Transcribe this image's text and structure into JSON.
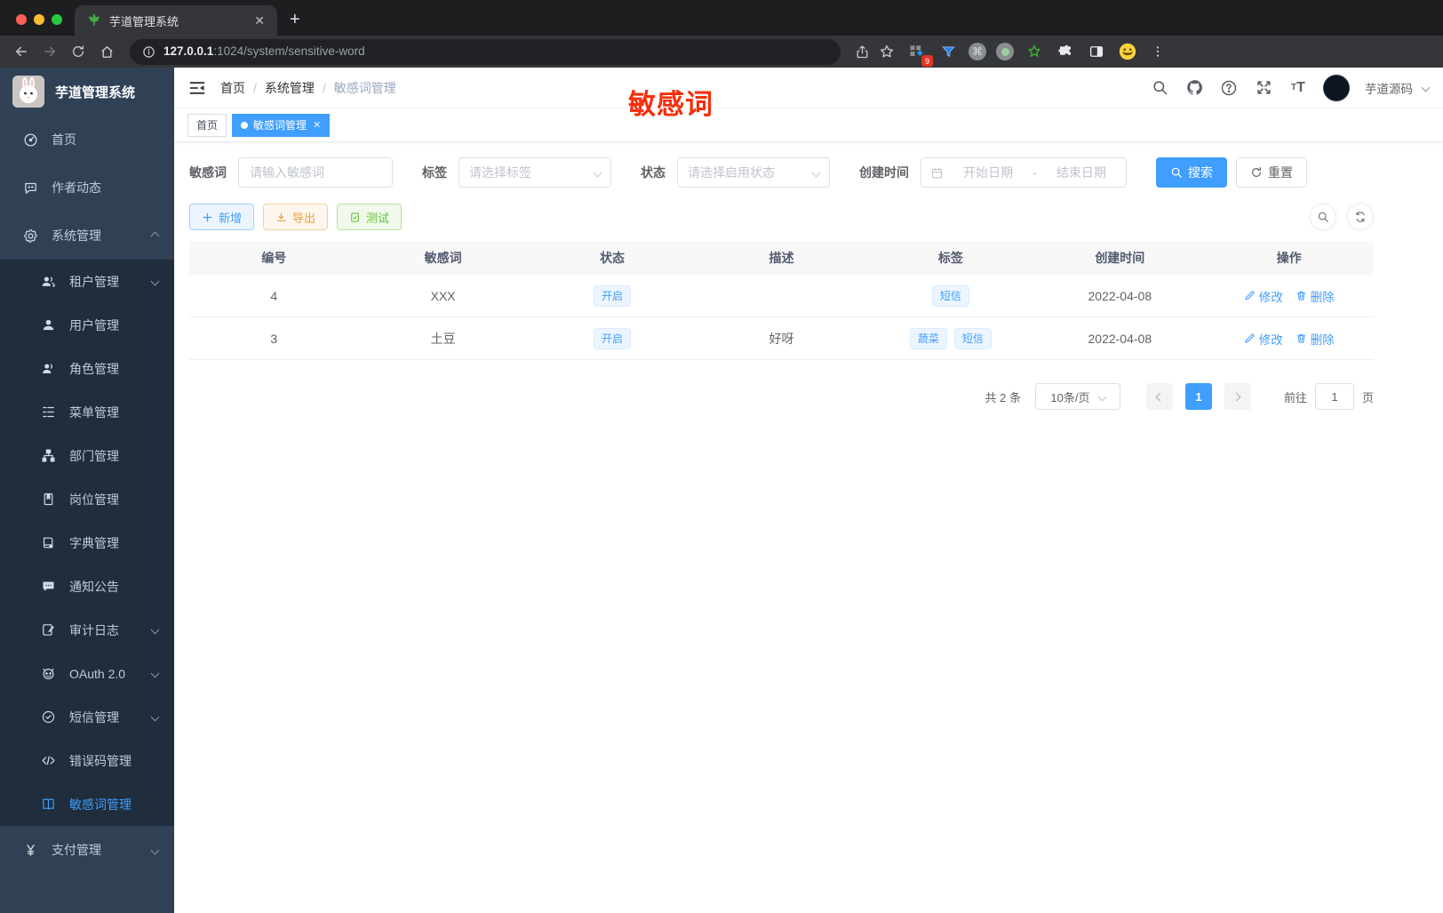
{
  "colors": {
    "accent": "#409eff",
    "sidebar_bg": "#304156",
    "submenu_bg": "#1f2d3d",
    "annotation_red": "#f62f0c",
    "tag_bg": "#ecf5ff",
    "tag_border": "#d9ecff",
    "warning": "#e6a23c",
    "success": "#67c23a"
  },
  "browser": {
    "tab_title": "芋道管理系统",
    "url_host": "127.0.0.1",
    "url_path": ":1024/system/sensitive-word",
    "extension_badge": "9"
  },
  "icons": {
    "favicon": "green-leaf",
    "back": "arrow-left",
    "forward": "arrow-right",
    "reload": "circular-arrow",
    "home": "house",
    "share": "box-arrow-up",
    "bookmark": "star-outline",
    "menu_fold": "lines-with-left-arrow",
    "search": "magnifier",
    "github": "octocat",
    "help": "question-circle",
    "fullscreen": "corner-arrows",
    "font_size": "double-T",
    "caret": "chevron-down",
    "calendar": "calendar-grid",
    "add": "plus",
    "export": "download-tray",
    "test": "document-check",
    "edit": "pen",
    "delete": "trash-can",
    "refresh": "circular-arrows",
    "more": "vertical-dots"
  },
  "sidebar": {
    "logo_title": "芋道管理系统",
    "items": [
      {
        "label": "首页"
      },
      {
        "label": "作者动态"
      },
      {
        "label": "系统管理"
      },
      {
        "label": "租户管理"
      },
      {
        "label": "用户管理"
      },
      {
        "label": "角色管理"
      },
      {
        "label": "菜单管理"
      },
      {
        "label": "部门管理"
      },
      {
        "label": "岗位管理"
      },
      {
        "label": "字典管理"
      },
      {
        "label": "通知公告"
      },
      {
        "label": "审计日志"
      },
      {
        "label": "OAuth 2.0"
      },
      {
        "label": "短信管理"
      },
      {
        "label": "错误码管理"
      },
      {
        "label": "敏感词管理"
      },
      {
        "label": "支付管理"
      }
    ]
  },
  "navbar": {
    "breadcrumb": [
      "首页",
      "系统管理",
      "敏感词管理"
    ],
    "username": "芋道源码"
  },
  "annotation": {
    "text": "敏感词"
  },
  "tabs_bar": {
    "tabs": [
      {
        "label": "首页"
      },
      {
        "label": "敏感词管理"
      }
    ]
  },
  "filters": {
    "keyword_label": "敏感词",
    "keyword_placeholder": "请输入敏感词",
    "tag_label": "标签",
    "tag_placeholder": "请选择标签",
    "status_label": "状态",
    "status_placeholder": "请选择启用状态",
    "date_label": "创建时间",
    "date_start_placeholder": "开始日期",
    "date_separator": "-",
    "date_end_placeholder": "结束日期",
    "search_label": "搜索",
    "reset_label": "重置"
  },
  "toolbar": {
    "add_label": "新增",
    "export_label": "导出",
    "test_label": "测试"
  },
  "table": {
    "columns": [
      "编号",
      "敏感词",
      "状态",
      "描述",
      "标签",
      "创建时间",
      "操作"
    ],
    "rows": [
      {
        "id": "4",
        "word": "XXX",
        "status": "开启",
        "description": "",
        "tags": [
          "短信"
        ],
        "created": "2022-04-08"
      },
      {
        "id": "3",
        "word": "土豆",
        "status": "开启",
        "description": "好呀",
        "tags": [
          "蔬菜",
          "短信"
        ],
        "created": "2022-04-08"
      }
    ],
    "edit_label": "修改",
    "delete_label": "删除"
  },
  "pagination": {
    "total": "共 2 条",
    "page_size": "10条/页",
    "page": "1",
    "goto_label": "前往",
    "goto_value": "1",
    "unit_label": "页"
  }
}
